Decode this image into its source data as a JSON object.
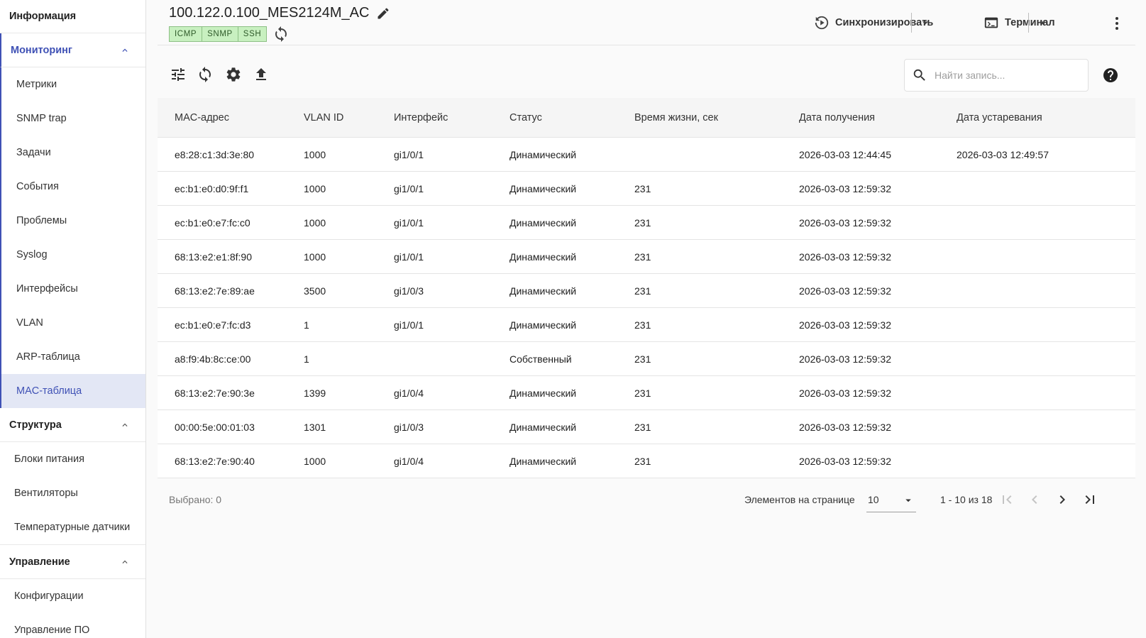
{
  "sidebar": {
    "info_label": "Информация",
    "groups": [
      {
        "label": "Мониторинг",
        "items": [
          "Метрики",
          "SNMP trap",
          "Задачи",
          "События",
          "Проблемы",
          "Syslog",
          "Интерфейсы",
          "VLAN",
          "ARP-таблица",
          "MAC-таблица"
        ],
        "active_item": "MAC-таблица"
      },
      {
        "label": "Структура",
        "items": [
          "Блоки питания",
          "Вентиляторы",
          "Температурные датчики"
        ]
      },
      {
        "label": "Управление",
        "items": [
          "Конфигурации",
          "Управление ПО"
        ]
      }
    ]
  },
  "header": {
    "device_title": "100.122.0.100_MES2124M_AC",
    "protocols": [
      "ICMP",
      "SNMP",
      "SSH"
    ],
    "sync_label": "Синхронизировать",
    "terminal_label": "Терминал"
  },
  "toolbar": {
    "search_placeholder": "Найти запись..."
  },
  "table": {
    "columns": [
      "MAC-адрес",
      "VLAN ID",
      "Интерфейс",
      "Статус",
      "Время жизни, сек",
      "Дата получения",
      "Дата устаревания"
    ],
    "rows": [
      [
        "e8:28:c1:3d:3e:80",
        "1000",
        "gi1/0/1",
        "Динамический",
        "",
        "2026-03-03 12:44:45",
        "2026-03-03 12:49:57"
      ],
      [
        "ec:b1:e0:d0:9f:f1",
        "1000",
        "gi1/0/1",
        "Динамический",
        "231",
        "2026-03-03 12:59:32",
        ""
      ],
      [
        "ec:b1:e0:e7:fc:c0",
        "1000",
        "gi1/0/1",
        "Динамический",
        "231",
        "2026-03-03 12:59:32",
        ""
      ],
      [
        "68:13:e2:e1:8f:90",
        "1000",
        "gi1/0/1",
        "Динамический",
        "231",
        "2026-03-03 12:59:32",
        ""
      ],
      [
        "68:13:e2:7e:89:ae",
        "3500",
        "gi1/0/3",
        "Динамический",
        "231",
        "2026-03-03 12:59:32",
        ""
      ],
      [
        "ec:b1:e0:e7:fc:d3",
        "1",
        "gi1/0/1",
        "Динамический",
        "231",
        "2026-03-03 12:59:32",
        ""
      ],
      [
        "a8:f9:4b:8c:ce:00",
        "1",
        "",
        "Собственный",
        "231",
        "2026-03-03 12:59:32",
        ""
      ],
      [
        "68:13:e2:7e:90:3e",
        "1399",
        "gi1/0/4",
        "Динамический",
        "231",
        "2026-03-03 12:59:32",
        ""
      ],
      [
        "00:00:5e:00:01:03",
        "1301",
        "gi1/0/3",
        "Динамический",
        "231",
        "2026-03-03 12:59:32",
        ""
      ],
      [
        "68:13:e2:7e:90:40",
        "1000",
        "gi1/0/4",
        "Динамический",
        "231",
        "2026-03-03 12:59:32",
        ""
      ]
    ]
  },
  "footer": {
    "selected_label": "Выбрано: 0",
    "per_page_label": "Элементов на странице",
    "per_page_value": "10",
    "range_label": "1 - 10 из 18"
  },
  "icons": {
    "edit": "pencil-icon",
    "protocol_refresh": "refresh-icon",
    "sync": "sync-play-icon",
    "terminal": "terminal-icon",
    "more": "more-vert-icon",
    "filter": "tune-icon",
    "reload": "refresh-icon",
    "settings": "gear-icon",
    "export": "upload-icon",
    "search": "search-icon",
    "help": "help-icon"
  },
  "colors": {
    "accent": "#3f51b5",
    "active_bg": "#e3e7f5",
    "badge_bg": "#c8f0c0"
  }
}
